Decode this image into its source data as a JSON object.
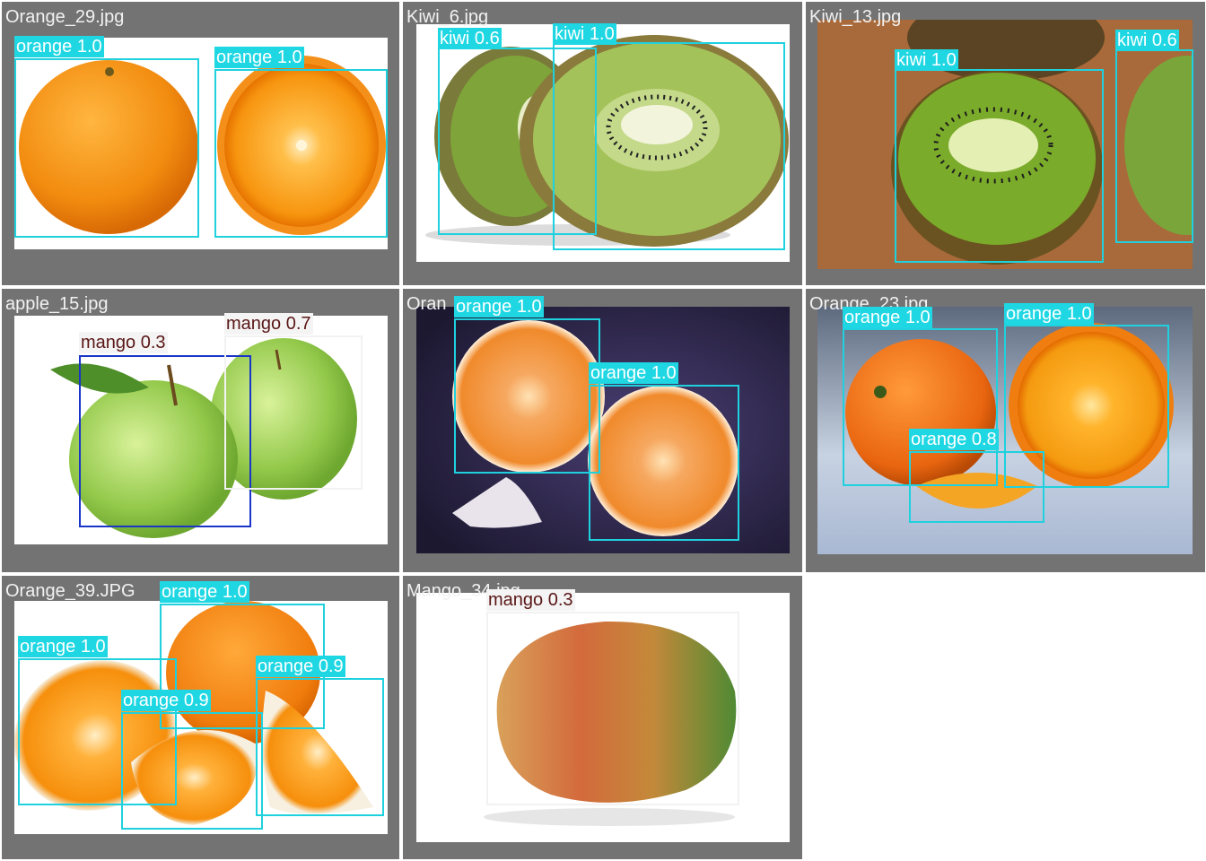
{
  "grid": {
    "cells": [
      {
        "filename": "Orange_29.jpg",
        "detections": [
          {
            "label": "orange 1.0",
            "class": "orange",
            "confidence": 1.0
          },
          {
            "label": "orange 1.0",
            "class": "orange",
            "confidence": 1.0
          }
        ]
      },
      {
        "filename": "Kiwi_6.jpg",
        "detections": [
          {
            "label": "kiwi 0.6",
            "class": "kiwi",
            "confidence": 0.6
          },
          {
            "label": "kiwi 1.0",
            "class": "kiwi",
            "confidence": 1.0
          }
        ]
      },
      {
        "filename": "Kiwi_13.jpg",
        "detections": [
          {
            "label": "kiwi 1.0",
            "class": "kiwi",
            "confidence": 1.0
          },
          {
            "label": "kiwi 0.6",
            "class": "kiwi",
            "confidence": 0.6
          }
        ]
      },
      {
        "filename": "apple_15.jpg",
        "detections": [
          {
            "label": "mango 0.3",
            "class": "mango",
            "confidence": 0.3
          },
          {
            "label": "mango 0.7",
            "class": "mango",
            "confidence": 0.7
          }
        ]
      },
      {
        "filename": "Oran",
        "detections": [
          {
            "label": "orange 1.0",
            "class": "orange",
            "confidence": 1.0
          },
          {
            "label": "orange 1.0",
            "class": "orange",
            "confidence": 1.0
          }
        ]
      },
      {
        "filename": "Orange_23.jpg",
        "detections": [
          {
            "label": "orange 1.0",
            "class": "orange",
            "confidence": 1.0
          },
          {
            "label": "orange 1.0",
            "class": "orange",
            "confidence": 1.0
          },
          {
            "label": "orange 0.8",
            "class": "orange",
            "confidence": 0.8
          }
        ]
      },
      {
        "filename": "Orange_39.JPG",
        "detections": [
          {
            "label": "orange 1.0",
            "class": "orange",
            "confidence": 1.0
          },
          {
            "label": "orange 1.0",
            "class": "orange",
            "confidence": 1.0
          },
          {
            "label": "orange 0.9",
            "class": "orange",
            "confidence": 0.9
          },
          {
            "label": "orange 0.9",
            "class": "orange",
            "confidence": 0.9
          }
        ]
      },
      {
        "filename": "Mango_34.jpg",
        "detections": [
          {
            "label": "mango 0.3",
            "class": "mango",
            "confidence": 0.3
          }
        ]
      }
    ]
  },
  "colors": {
    "cell_background": "#737373",
    "orange_kiwi_box": "#1fd1de",
    "mango_box_white": "#f2f2f2",
    "mango_box_blue": "#1a36c8",
    "mango_label_text": "#5a1616"
  }
}
